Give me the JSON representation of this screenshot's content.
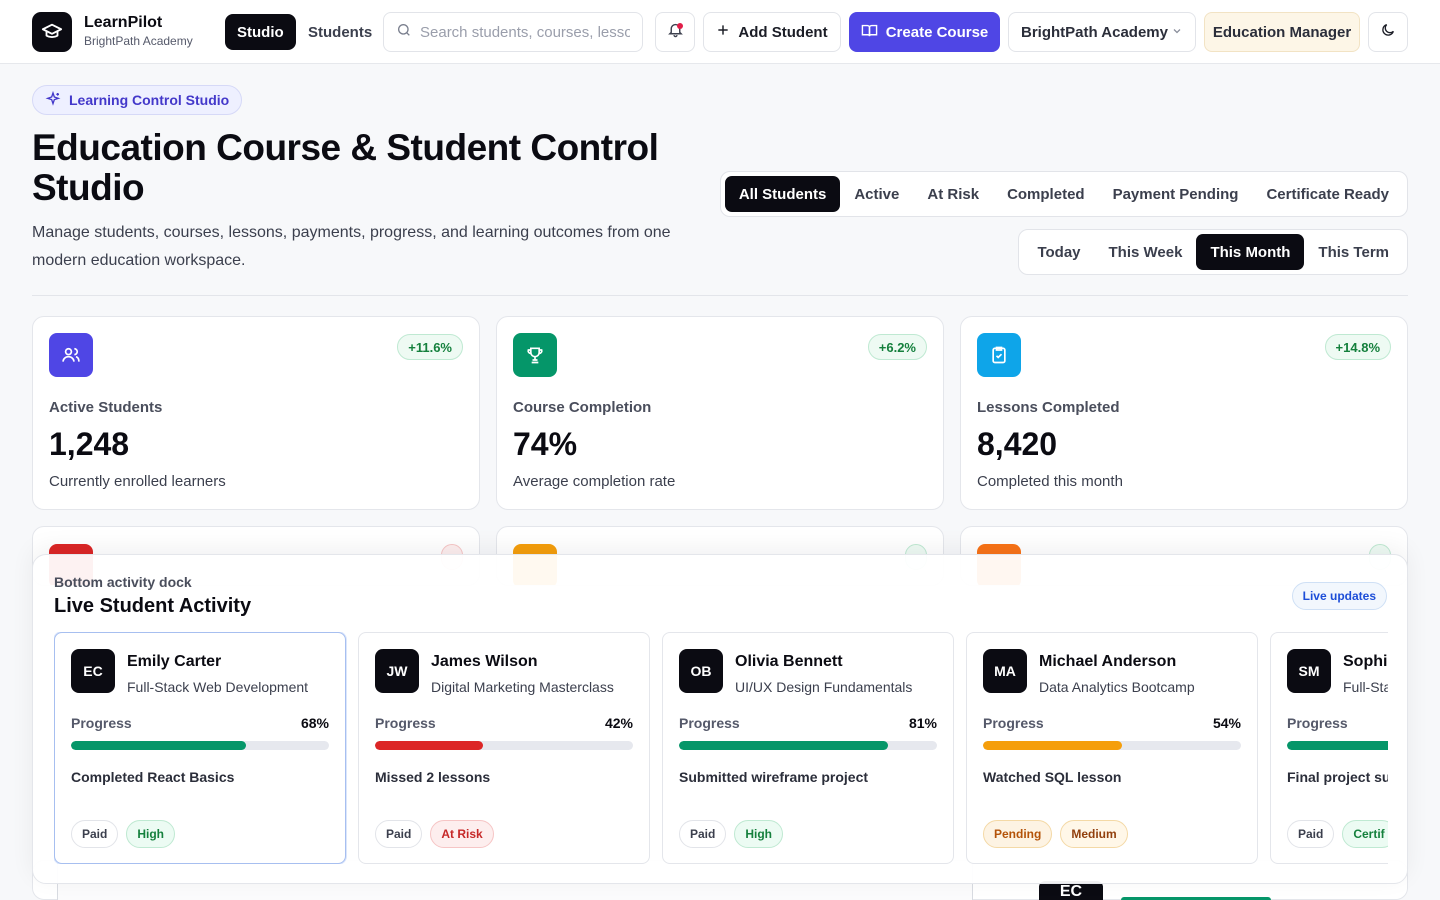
{
  "brand": {
    "name": "LearnPilot",
    "org": "BrightPath Academy"
  },
  "nav": {
    "studio": "Studio",
    "students": "Students"
  },
  "search": {
    "placeholder": "Search students, courses, lessons"
  },
  "actions": {
    "add_student": "Add Student",
    "create_course": "Create Course"
  },
  "academy_select": {
    "value": "BrightPath Academy"
  },
  "role": "Education Manager",
  "hero": {
    "pill": "Learning Control Studio",
    "title": "Education Course & Student Control Studio",
    "subtitle": "Manage students, courses, lessons, payments, progress, and learning outcomes from one modern education workspace."
  },
  "status_filters": {
    "selected": "All Students",
    "items": [
      "All Students",
      "Active",
      "At Risk",
      "Completed",
      "Payment Pending",
      "Certificate Ready"
    ]
  },
  "period_filters": {
    "selected": "This Month",
    "items": [
      "Today",
      "This Week",
      "This Month",
      "This Term"
    ]
  },
  "stats": [
    {
      "label": "Active Students",
      "value": "1,248",
      "desc": "Currently enrolled learners",
      "change": "+11.6%",
      "icon": "users-icon",
      "color": "#4f46e5"
    },
    {
      "label": "Course Completion",
      "value": "74%",
      "desc": "Average completion rate",
      "change": "+6.2%",
      "icon": "trophy-icon",
      "color": "#059669"
    },
    {
      "label": "Lessons Completed",
      "value": "8,420",
      "desc": "Completed this month",
      "change": "+14.8%",
      "icon": "clipboard-check-icon",
      "color": "#0ea5e9"
    }
  ],
  "stats_row2_colors": [
    "#dc2626",
    "#f59e0b",
    "#f97316"
  ],
  "dock": {
    "kicker": "Bottom activity dock",
    "title": "Live Student Activity",
    "live": "Live updates",
    "progress_label": "Progress",
    "students": [
      {
        "initials": "EC",
        "name": "Emily Carter",
        "course": "Full-Stack Web Development",
        "progress": 68,
        "progress_text": "68%",
        "bar_color": "#059669",
        "activity": "Completed React Basics",
        "payment": "Paid",
        "status": "High",
        "status_tone": "g",
        "payment_tone": ""
      },
      {
        "initials": "JW",
        "name": "James Wilson",
        "course": "Digital Marketing Masterclass",
        "progress": 42,
        "progress_text": "42%",
        "bar_color": "#dc2626",
        "activity": "Missed 2 lessons",
        "payment": "Paid",
        "status": "At Risk",
        "status_tone": "r",
        "payment_tone": ""
      },
      {
        "initials": "OB",
        "name": "Olivia Bennett",
        "course": "UI/UX Design Fundamentals",
        "progress": 81,
        "progress_text": "81%",
        "bar_color": "#059669",
        "activity": "Submitted wireframe project",
        "payment": "Paid",
        "status": "High",
        "status_tone": "g",
        "payment_tone": ""
      },
      {
        "initials": "MA",
        "name": "Michael Anderson",
        "course": "Data Analytics Bootcamp",
        "progress": 54,
        "progress_text": "54%",
        "bar_color": "#f59e0b",
        "activity": "Watched SQL lesson",
        "payment": "Pending",
        "status": "Medium",
        "status_tone": "y",
        "payment_tone": "o"
      },
      {
        "initials": "SM",
        "name": "Sophi",
        "course": "Full-Sta",
        "progress": 92,
        "progress_text": "",
        "bar_color": "#059669",
        "activity": "Final project su",
        "payment": "Paid",
        "status": "Certif",
        "status_tone": "g",
        "payment_tone": ""
      }
    ]
  },
  "behind": {
    "initials": "EC"
  }
}
